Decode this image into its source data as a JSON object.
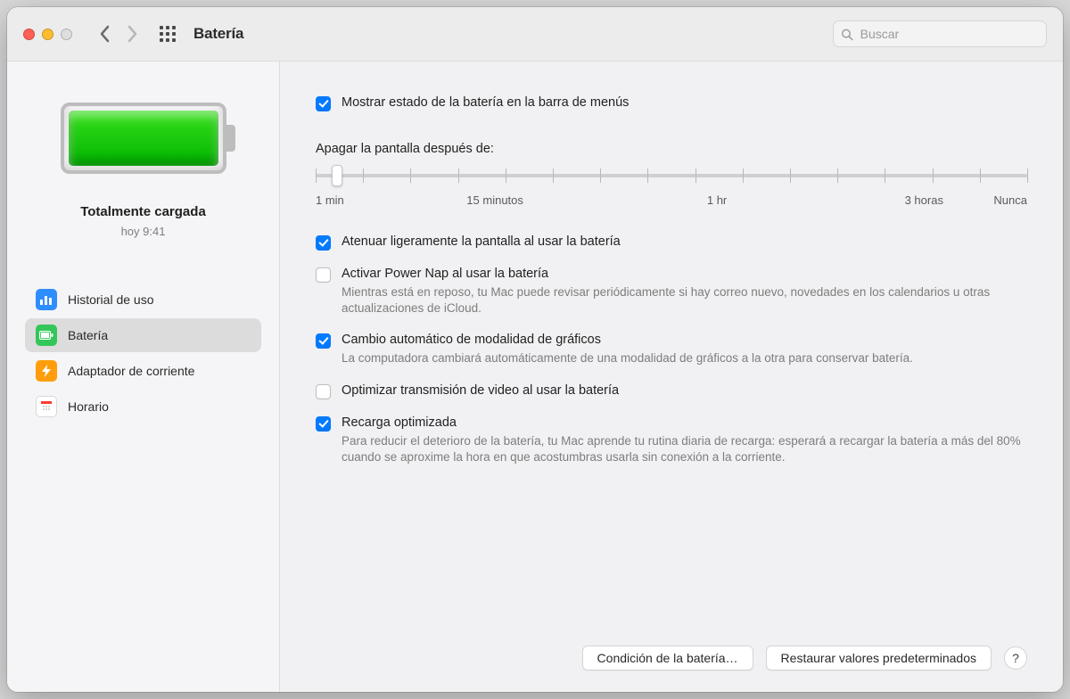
{
  "window": {
    "title": "Batería"
  },
  "search": {
    "placeholder": "Buscar"
  },
  "sidebar": {
    "status": "Totalmente cargada",
    "timestamp": "hoy 9:41",
    "items": [
      {
        "label": "Historial de uso"
      },
      {
        "label": "Batería"
      },
      {
        "label": "Adaptador de corriente"
      },
      {
        "label": "Horario"
      }
    ]
  },
  "options": {
    "menubar": {
      "label": "Mostrar estado de la batería en la barra de menús",
      "checked": true
    },
    "dim": {
      "label": "Atenuar ligeramente la pantalla al usar la batería",
      "checked": true
    },
    "powernap": {
      "label": "Activar Power Nap al usar la batería",
      "checked": false,
      "desc": "Mientras está en reposo, tu Mac puede revisar periódicamente si hay correo nuevo, novedades en los calendarios u otras actualizaciones de iCloud."
    },
    "gpu": {
      "label": "Cambio automático de modalidad de gráficos",
      "checked": true,
      "desc": "La computadora cambiará automáticamente de una modalidad de gráficos a la otra para conservar batería."
    },
    "video": {
      "label": "Optimizar transmisión de video al usar la batería",
      "checked": false
    },
    "optcharge": {
      "label": "Recarga optimizada",
      "checked": true,
      "desc": "Para reducir el deterioro de la batería, tu Mac aprende tu rutina diaria de recarga: esperará a recargar la batería a más del 80% cuando se aproxime la hora en que acostumbras usarla sin conexión a la corriente."
    }
  },
  "slider": {
    "heading": "Apagar la pantalla después de:",
    "value_pct": 3,
    "labels": [
      "1 min",
      "15 minutos",
      "1 hr",
      "3 horas",
      "Nunca"
    ],
    "label_pos": [
      0,
      25.2,
      56.4,
      85.5,
      100
    ]
  },
  "footer": {
    "health": "Condición de la batería…",
    "restore": "Restaurar valores predeterminados",
    "help": "?"
  }
}
